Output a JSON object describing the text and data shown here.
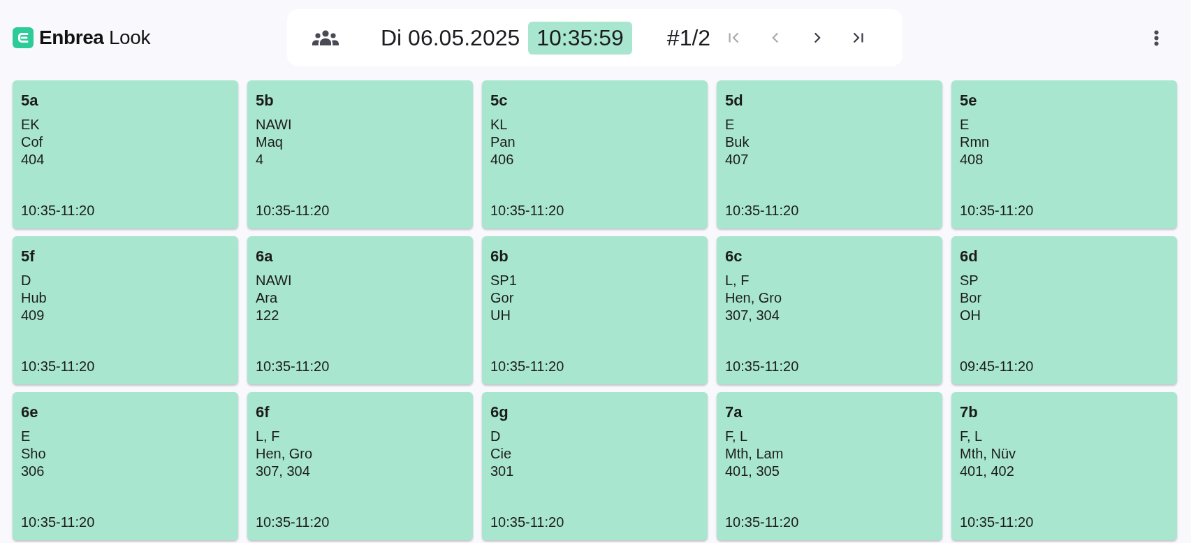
{
  "brand": "**Enbrea** Look",
  "toolbar": {
    "date": "Di 06.05.2025",
    "time": "10:35:59",
    "page": "#1/2",
    "nav": [
      {
        "kind": "first",
        "disabled": true
      },
      {
        "kind": "previous",
        "disabled": true
      },
      {
        "kind": "next",
        "disabled": false
      },
      {
        "kind": "last",
        "disabled": false
      }
    ]
  },
  "lessons": [
    {
      "class": "5a",
      "subject": "EK",
      "teacher": "Cof",
      "room": "404",
      "time": "10:35-11:20"
    },
    {
      "class": "5b",
      "subject": "NAWI",
      "teacher": "Maq",
      "room": "4",
      "time": "10:35-11:20"
    },
    {
      "class": "5c",
      "subject": "KL",
      "teacher": "Pan",
      "room": "406",
      "time": "10:35-11:20"
    },
    {
      "class": "5d",
      "subject": "E",
      "teacher": "Buk",
      "room": "407",
      "time": "10:35-11:20"
    },
    {
      "class": "5e",
      "subject": "E",
      "teacher": "Rmn",
      "room": "408",
      "time": "10:35-11:20"
    },
    {
      "class": "5f",
      "subject": "D",
      "teacher": "Hub",
      "room": "409",
      "time": "10:35-11:20"
    },
    {
      "class": "6a",
      "subject": "NAWI",
      "teacher": "Ara",
      "room": "122",
      "time": "10:35-11:20"
    },
    {
      "class": "6b",
      "subject": "SP1",
      "teacher": "Gor",
      "room": "UH",
      "time": "10:35-11:20"
    },
    {
      "class": "6c",
      "subject": "L, F",
      "teacher": "Hen, Gro",
      "room": "307, 304",
      "time": "10:35-11:20"
    },
    {
      "class": "6d",
      "subject": "SP",
      "teacher": "Bor",
      "room": "OH",
      "time": "09:45-11:20"
    },
    {
      "class": "6e",
      "subject": "E",
      "teacher": "Sho",
      "room": "306",
      "time": "10:35-11:20"
    },
    {
      "class": "6f",
      "subject": "L, F",
      "teacher": "Hen, Gro",
      "room": "307, 304",
      "time": "10:35-11:20"
    },
    {
      "class": "6g",
      "subject": "D",
      "teacher": "Cie",
      "room": "301",
      "time": "10:35-11:20"
    },
    {
      "class": "7a",
      "subject": "F, L",
      "teacher": "Mth, Lam",
      "room": "401, 305",
      "time": "10:35-11:20"
    },
    {
      "class": "7b",
      "subject": "F, L",
      "teacher": "Mth, Nüv",
      "room": "401, 402",
      "time": "10:35-11:20"
    }
  ]
}
